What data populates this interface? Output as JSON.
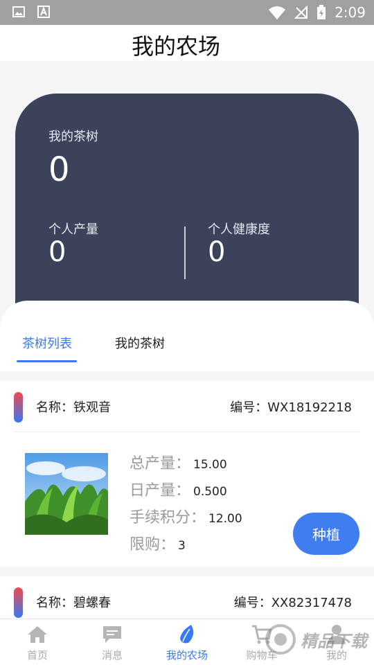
{
  "status_bar": {
    "time": "2:09"
  },
  "app_bar": {
    "title": "我的农场"
  },
  "summary": {
    "trees_label": "我的茶树",
    "trees_value": "0",
    "output_label": "个人产量",
    "output_value": "0",
    "health_label": "个人健康度",
    "health_value": "0",
    "colors": {
      "card_bg": "#3b435b"
    }
  },
  "tabs": [
    {
      "label": "茶树列表",
      "active": true
    },
    {
      "label": "我的茶树",
      "active": false
    }
  ],
  "tea_trees": [
    {
      "name": "名称：铁观音",
      "code": "编号：WX18192218",
      "total_label": "总产量：",
      "total_value": "15.00",
      "daily_label": "日产量：",
      "daily_value": "0.500",
      "fee_label": "手续积分：",
      "fee_value": "12.00",
      "limit_label": "限购：",
      "limit_value": "3",
      "action_label": "种植"
    },
    {
      "name": "名称：碧螺春",
      "code": "编号：XX82317478"
    }
  ],
  "bottom_nav": [
    {
      "label": "首页",
      "icon": "home-icon",
      "active": false
    },
    {
      "label": "消息",
      "icon": "message-icon",
      "active": false
    },
    {
      "label": "我的农场",
      "icon": "leaf-icon",
      "active": true
    },
    {
      "label": "购物车",
      "icon": "cart-icon",
      "active": false
    },
    {
      "label": "我的",
      "icon": "user-icon",
      "active": false
    }
  ],
  "watermark": {
    "text": "精品下载"
  },
  "colors": {
    "accent": "#3a78f2",
    "button": "#3f7df0"
  }
}
